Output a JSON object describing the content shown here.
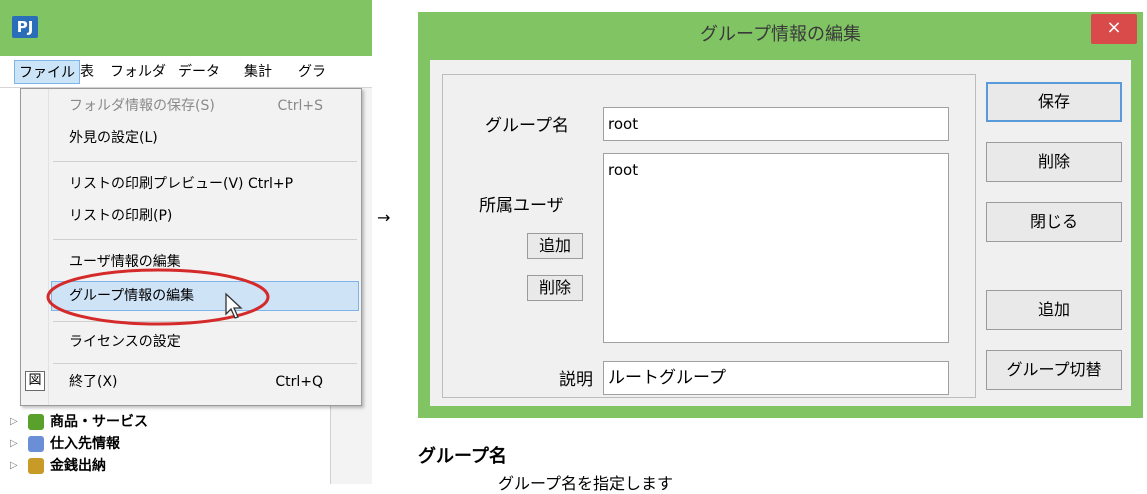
{
  "app": {
    "logo_text": "PJ",
    "accent_color": "#80c464",
    "menubar": [
      "ファイル",
      "表",
      "フォルダ",
      "データ",
      "集計",
      "グラ"
    ],
    "file_menu": {
      "items": [
        {
          "label": "フォルダ情報の保存(S)",
          "shortcut": "Ctrl+S",
          "disabled": true
        },
        {
          "label": "外見の設定(L)",
          "shortcut": ""
        },
        {
          "label": "リストの印刷プレビュー(V) Ctrl+P",
          "shortcut": ""
        },
        {
          "label": "リストの印刷(P)",
          "shortcut": ""
        },
        {
          "label": "ユーザ情報の編集",
          "shortcut": ""
        },
        {
          "label": "グループ情報の編集",
          "shortcut": "",
          "highlighted": true
        },
        {
          "label": "ライセンスの設定",
          "shortcut": ""
        },
        {
          "label": "終了(X)",
          "shortcut": "Ctrl+Q"
        }
      ],
      "exit_icon_glyph": "図"
    },
    "tree": [
      {
        "label": "商品・サービス",
        "icon": "products-icon",
        "color": "#5aa02c"
      },
      {
        "label": "仕入先情報",
        "icon": "suppliers-icon",
        "color": "#6a8fd6"
      },
      {
        "label": "金銭出納",
        "icon": "cashbook-icon",
        "color": "#c89a28"
      }
    ]
  },
  "arrow": "→",
  "dialog": {
    "title": "グループ情報の編集",
    "close_glyph": "×",
    "group_name_label": "グループ名",
    "group_name_value": "root",
    "members_label": "所属ユーザ",
    "members": [
      "root"
    ],
    "add_member_label": "追加",
    "remove_member_label": "削除",
    "description_label": "説明",
    "description_value": "ルートグループ",
    "buttons": {
      "save": "保存",
      "delete": "削除",
      "close": "閉じる",
      "add": "追加",
      "switch": "グループ切替"
    }
  },
  "doc": {
    "heading": "グループ名",
    "description": "グループ名を指定します"
  }
}
